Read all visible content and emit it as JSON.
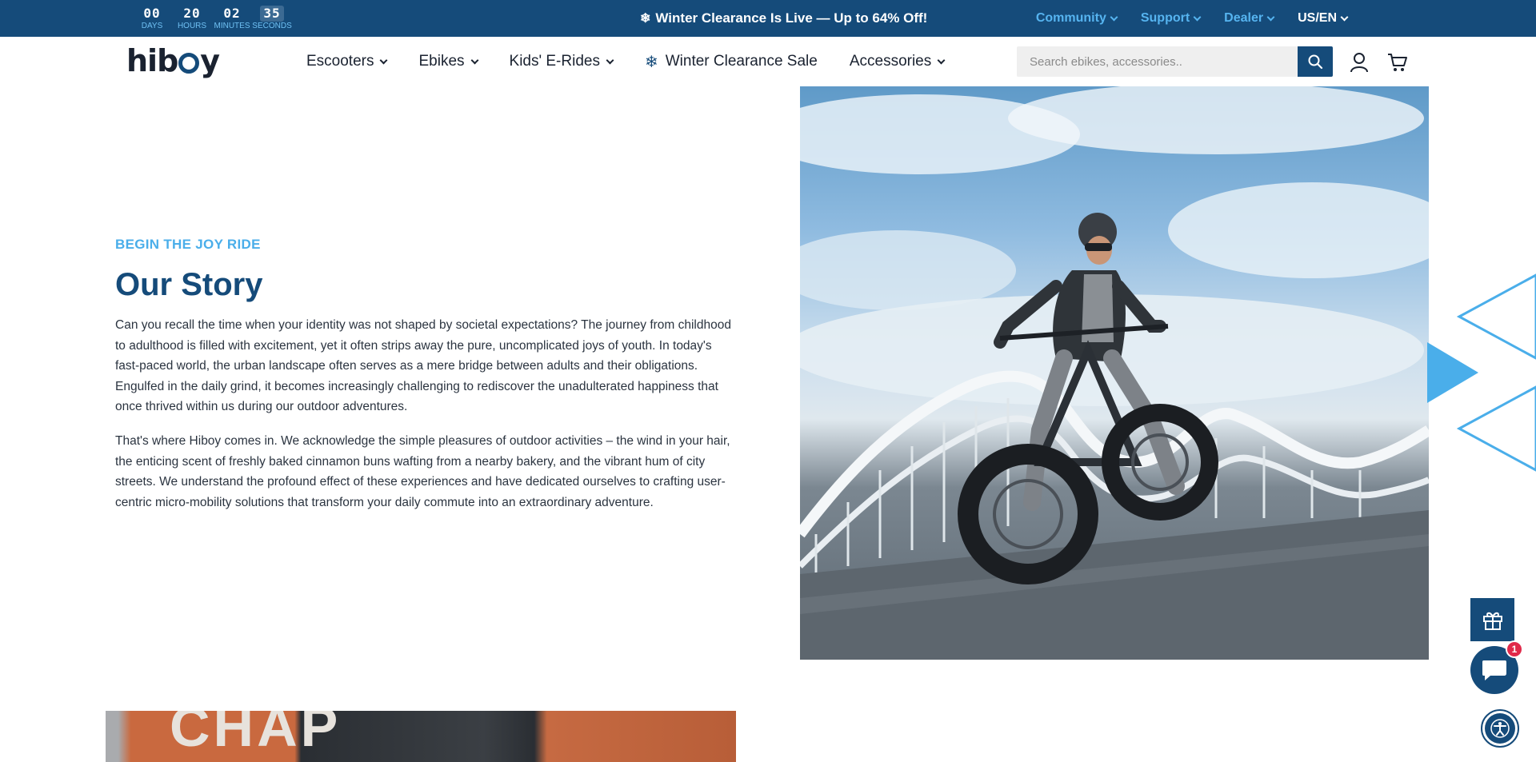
{
  "countdown": {
    "days": {
      "value": "00",
      "label": "DAYS"
    },
    "hours": {
      "value": "20",
      "label": "HOURS"
    },
    "minutes": {
      "value": "02",
      "label": "MINUTES"
    },
    "seconds": {
      "value": "35",
      "label": "SECONDS"
    }
  },
  "promo": {
    "text": "Winter Clearance Is Live — Up to 64% Off!",
    "icon": "snowflake-icon"
  },
  "topnav": {
    "community": "Community",
    "support": "Support",
    "dealer": "Dealer",
    "locale": "US/EN"
  },
  "header": {
    "logo_left": "hib",
    "logo_right": "y",
    "nav": {
      "escooters": "Escooters",
      "ebikes": "Ebikes",
      "kids": "Kids' E-Rides",
      "clearance": "Winter Clearance Sale",
      "accessories": "Accessories"
    },
    "search": {
      "placeholder": "Search ebikes, accessories.."
    }
  },
  "content": {
    "eyebrow": "BEGIN THE JOY RIDE",
    "title": "Our Story",
    "paragraph1": "Can you recall the time when your identity was not shaped by societal expectations? The journey from childhood to adulthood is filled with excitement, yet it often strips away the pure, uncomplicated joys of youth. In today's fast-paced world, the urban landscape often serves as a mere bridge between adults and their obligations. Engulfed in the daily grind, it becomes increasingly challenging to rediscover the unadulterated happiness that once thrived within us during our outdoor adventures.",
    "paragraph2": "That's where Hiboy comes in. We acknowledge the simple pleasures of outdoor activities – the wind in your hair, the enticing scent of freshly baked cinnamon buns wafting from a nearby bakery, and the vibrant hum of city streets. We understand the profound effect of these experiences and have dedicated ourselves to crafting user-centric micro-mobility solutions that transform your daily commute into an extraordinary adventure."
  },
  "store_sign": "CHAP",
  "widgets": {
    "chat_badge": "1"
  },
  "colors": {
    "brand": "#154b7a",
    "accent": "#4aaeea",
    "badge": "#e0294a"
  }
}
